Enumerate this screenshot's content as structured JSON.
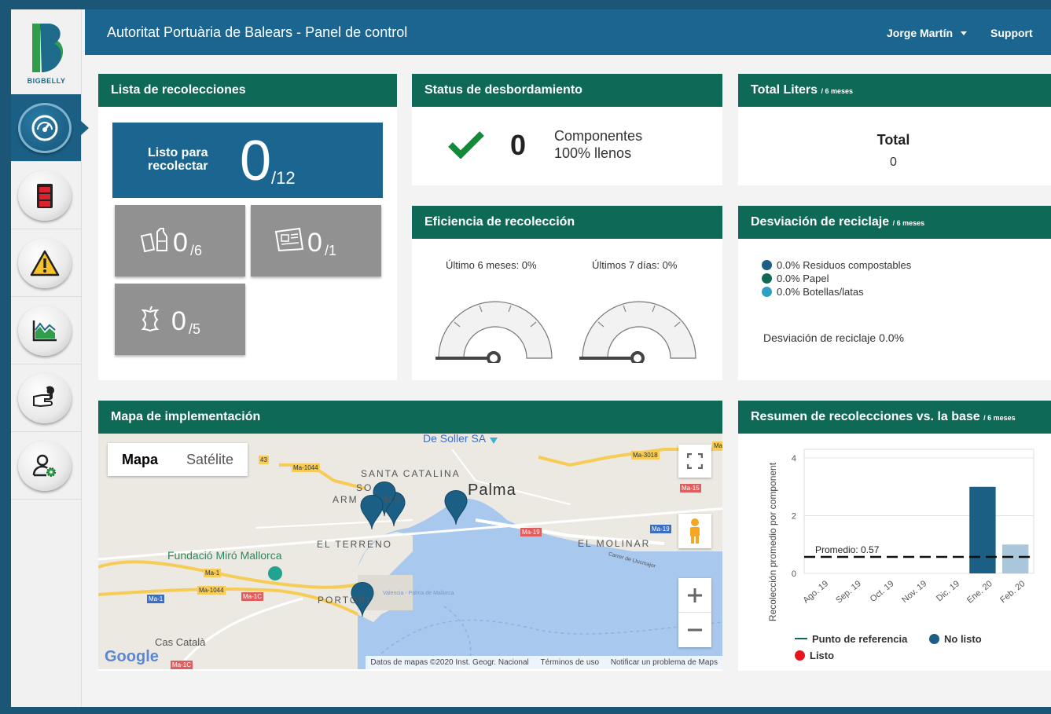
{
  "brand": {
    "name": "BIGBELLY"
  },
  "header": {
    "title": "Autoritat Portuària de Balears - Panel de control",
    "user": "Jorge Martín",
    "support": "Support"
  },
  "sidebar": {
    "items": [
      {
        "name": "dashboard",
        "icon": "speedometer-icon",
        "active": true
      },
      {
        "name": "fill-status",
        "icon": "battery-icon",
        "active": false
      },
      {
        "name": "alerts",
        "icon": "warning-icon",
        "active": false
      },
      {
        "name": "reports",
        "icon": "chart-icon",
        "active": false
      },
      {
        "name": "operations",
        "icon": "hand-wrench-icon",
        "active": false
      },
      {
        "name": "admin",
        "icon": "user-gear-icon",
        "active": false
      }
    ]
  },
  "collections": {
    "title": "Lista de recolecciones",
    "ready_label": "Listo para recolectar",
    "ready_count": "0",
    "ready_total": "/12",
    "tiles": [
      {
        "icon": "bottles-icon",
        "count": "0",
        "total": "/6"
      },
      {
        "icon": "newspaper-icon",
        "count": "0",
        "total": "/1"
      },
      {
        "icon": "apple-core-icon",
        "count": "0",
        "total": "/5"
      }
    ]
  },
  "overflow": {
    "title": "Status de desbordamiento",
    "count": "0",
    "label_line1": "Componentes",
    "label_line2": "100% llenos"
  },
  "total_liters": {
    "title": "Total Liters",
    "period": "/ 6 meses",
    "label": "Total",
    "value": "0"
  },
  "efficiency": {
    "title": "Eficiencia de recolección",
    "gauges": [
      {
        "label": "Último 6 meses: 0%",
        "value": 0
      },
      {
        "label": "Últimos 7 días: 0%",
        "value": 0
      }
    ]
  },
  "recycling": {
    "title": "Desviación de reciclaje",
    "period": "/ 6 meses",
    "legend": [
      {
        "label": "0.0% Residuos compostables",
        "color": "#1b5f84"
      },
      {
        "label": "0.0% Papel",
        "color": "#0e6a56"
      },
      {
        "label": "0.0% Botellas/latas",
        "color": "#2f9fc4"
      }
    ],
    "total": "Desviación de reciclaje 0.0%"
  },
  "map": {
    "title": "Mapa de implementación",
    "type_map": "Mapa",
    "type_satellite": "Satélite",
    "labels": [
      "De Soller SA",
      "SANTA CATALINA",
      "Palma",
      "SO",
      "ARM",
      "MS",
      "EL TERRENO",
      "EL MOLINAR",
      "Fundació Miró Mallorca",
      "PORTOPI",
      "Cas Català",
      "Carrer de Llucmajor",
      "Valencia - Palma de Mallorca"
    ],
    "roads": [
      "Ma-1044",
      "Ma-3018",
      "Ma-15",
      "Ma-19",
      "Ma-19",
      "Ma-1",
      "Ma-1044",
      "Ma-1C",
      "Ma-1",
      "Ma-1C",
      "43",
      "Ma"
    ],
    "google": "Google",
    "footer": {
      "data": "Datos de mapas ©2020 Inst. Geogr. Nacional",
      "terms": "Términos de uso",
      "report": "Notificar un problema de Maps"
    }
  },
  "summary": {
    "title": "Resumen de recolecciones vs. la base",
    "period": "/ 6 meses",
    "legend": {
      "reference": "Punto de referencia",
      "not_ready": "No listo",
      "ready": "Listo"
    }
  },
  "chart_data": {
    "type": "bar",
    "ylabel": "Recolección promedio por component",
    "categories": [
      "Ago. 19",
      "Sep. 19",
      "Oct. 19",
      "Nov. 19",
      "Dic. 19",
      "Ene. 20",
      "Feb. 20"
    ],
    "series": [
      {
        "name": "No listo",
        "values": [
          0,
          0,
          0,
          0,
          0,
          3,
          1
        ],
        "color": "#1b5f84",
        "faded_last": true
      },
      {
        "name": "Listo",
        "values": [
          0,
          0,
          0,
          0,
          0,
          0,
          0
        ],
        "color": "#e8141c"
      }
    ],
    "reference": {
      "name": "Punto de referencia",
      "label": "Promedio: 0.57",
      "value": 0.57
    },
    "yticks": [
      "0",
      "2",
      "4"
    ],
    "ylim": [
      0,
      4.3
    ]
  }
}
